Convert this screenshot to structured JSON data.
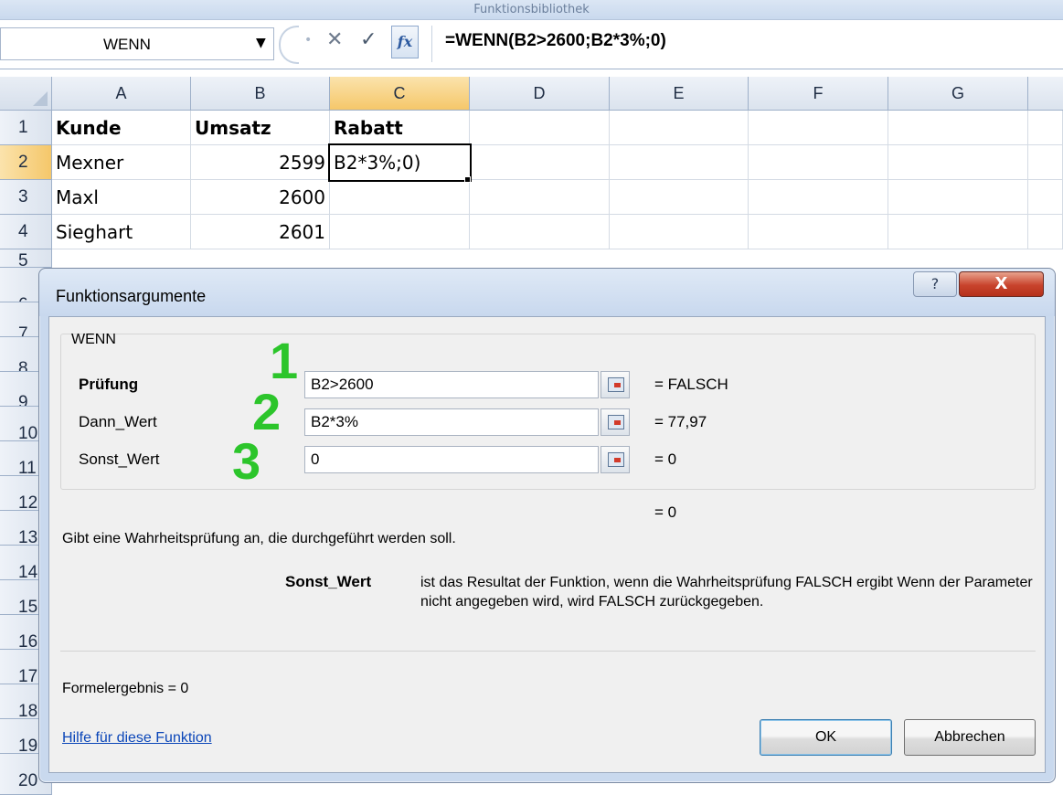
{
  "ribbon": {
    "group_label": "Funktionsbibliothek"
  },
  "formula_bar": {
    "name_box": "WENN",
    "formula": "=WENN(B2>2600;B2*3%;0)",
    "fx_label": "fx"
  },
  "grid": {
    "columns": [
      "A",
      "B",
      "C",
      "D",
      "E",
      "F",
      "G"
    ],
    "rows": [
      "1",
      "2",
      "3",
      "4",
      "5",
      "6",
      "7",
      "8",
      "9",
      "10",
      "11",
      "12",
      "13",
      "14",
      "15",
      "16",
      "17",
      "18",
      "19",
      "20"
    ],
    "cells": {
      "A1": "Kunde",
      "B1": "Umsatz",
      "C1": "Rabatt",
      "A2": "Mexner",
      "B2": "2599",
      "C2": "B2*3%;0)",
      "A3": "Maxl",
      "B3": "2600",
      "A4": "Sieghart",
      "B4": "2601"
    }
  },
  "dialog": {
    "title": "Funktionsargumente",
    "help_glyph": "?",
    "close_glyph": "X",
    "function_name": "WENN",
    "arguments": [
      {
        "label": "Prüfung",
        "value": "B2>2600",
        "result": "=  FALSCH",
        "marker": "1"
      },
      {
        "label": "Dann_Wert",
        "value": "B2*3%",
        "result": "=  77,97",
        "marker": "2"
      },
      {
        "label": "Sonst_Wert",
        "value": "0",
        "result": "=  0",
        "marker": "3"
      }
    ],
    "total_result": "=  0",
    "description": "Gibt eine Wahrheitsprüfung an, die durchgeführt werden soll.",
    "param_name": "Sonst_Wert",
    "param_description": "ist das Resultat der Funktion, wenn die Wahrheitsprüfung FALSCH ergibt Wenn der Parameter nicht angegeben wird, wird FALSCH zurückgegeben.",
    "formula_result": "Formelergebnis =  0",
    "help_link": "Hilfe für diese Funktion",
    "ok_label": "OK",
    "cancel_label": "Abbrechen"
  },
  "colors": {
    "marker": "#2cc52b",
    "active_header": "#f5c76a",
    "link": "#0b46b8"
  }
}
